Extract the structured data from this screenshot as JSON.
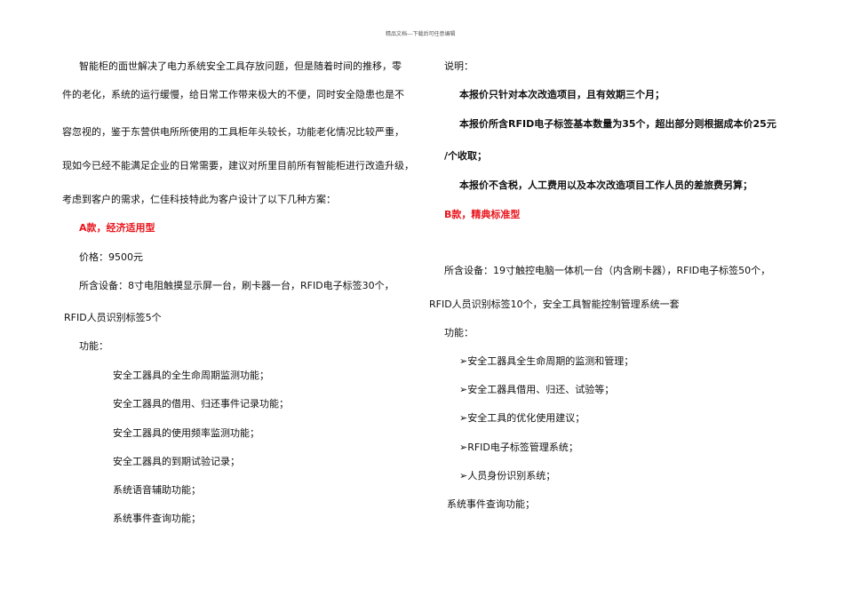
{
  "header": "精品文档---下载后可任意编辑",
  "left": {
    "intro": [
      "智能柜的面世解决了电力系统安全工具存放问题，但是随着时间的推移，零",
      "件的老化，系统的运行缓慢，给日常工作带来极大的不便，同时安全隐患也是不",
      "容忽视的，鉴于东营供电所所使用的工具柜年头较长，功能老化情况比较严重，",
      "现如今已经不能满足企业的日常需要，建议对所里目前所有智能柜进行改造升级，",
      "考虑到客户的需求，仁佳科技特此为客户设计了以下几种方案："
    ],
    "a_title": "A款，经济适用型",
    "price": "价格：9500元",
    "equip1": "所含设备：8寸电阻触摸显示屏一台，刷卡器一台，RFID电子标签30个，",
    "equip2": "RFID人员识别标签5个",
    "func": "功能：",
    "items": [
      "安全工器具的全生命周期监测功能；",
      "安全工器具的借用、归还事件记录功能；",
      "安全工器具的使用频率监测功能；",
      "安全工器具的到期试验记录；",
      "系统语音辅助功能；",
      "系统事件查询功能；"
    ]
  },
  "right": {
    "note": "说明：",
    "notes": [
      "本报价只针对本次改造项目，且有效期三个月；",
      "本报价所含RFID电子标签基本数量为35个，超出部分则根据成本价25元",
      "/个收取；",
      "本报价不含税，人工费用以及本次改造项目工作人员的差旅费另算；"
    ],
    "b_title": "B款，精典标准型",
    "equip1": "所含设备：19寸触控电脑一体机一台（内含刷卡器），RFID电子标签50个，",
    "equip2": "RFID人员识别标签10个，安全工具智能控制管理系统一套",
    "func": "功能：",
    "items": [
      "➢安全工器具全生命周期的监测和管理；",
      "➢安全工器具借用、归还、试验等；",
      "➢安全工具的优化使用建议；",
      "➢RFID电子标签管理系统；",
      "➢人员身份识别系统；"
    ],
    "last": "系统事件查询功能；"
  }
}
